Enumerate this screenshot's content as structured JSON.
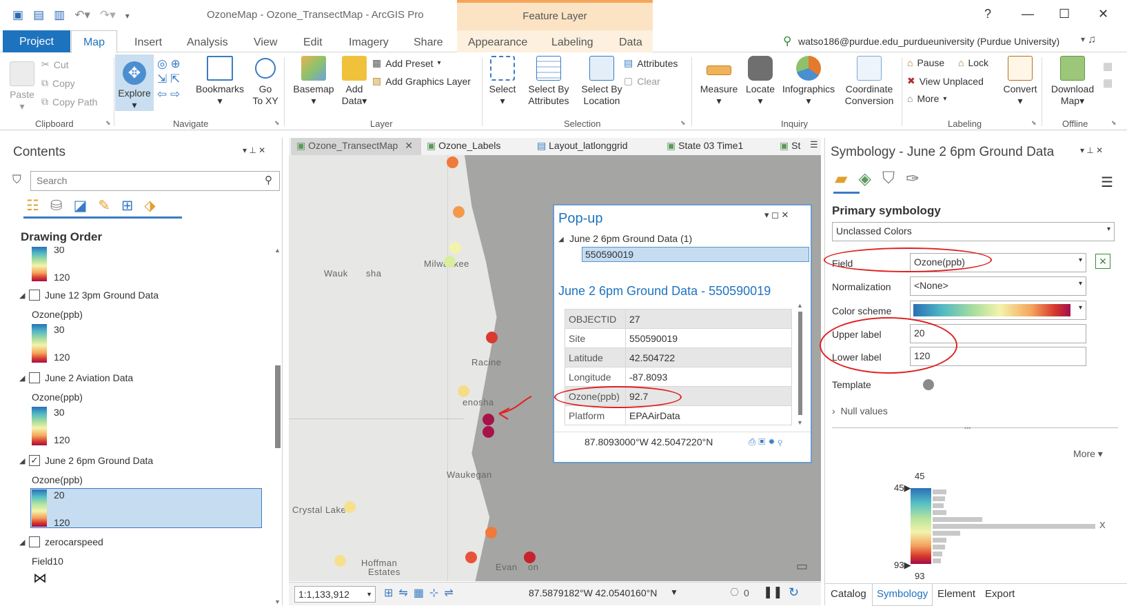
{
  "window": {
    "title": "OzoneMap - Ozone_TransectMap - ArcGIS Pro",
    "context_tab": "Feature Layer",
    "help": "?",
    "minimize": "—",
    "maximize": "☐",
    "close": "✕"
  },
  "ribbon_tabs": [
    "Project",
    "Map",
    "Insert",
    "Analysis",
    "View",
    "Edit",
    "Imagery",
    "Share",
    "Appearance",
    "Labeling",
    "Data"
  ],
  "user": "watso186@purdue.edu_purdueuniversity (Purdue University)",
  "ribbon": {
    "clipboard": {
      "paste": "Paste",
      "cut": "Cut",
      "copy": "Copy",
      "copy_path": "Copy Path",
      "label": "Clipboard"
    },
    "navigate": {
      "explore": "Explore",
      "bookmarks": "Bookmarks",
      "go_to": "Go",
      "go_to2": "To XY",
      "label": "Navigate"
    },
    "layer": {
      "basemap": "Basemap",
      "add": "Add",
      "data": "Data",
      "add_preset": "Add Preset",
      "add_graphics": "Add Graphics Layer",
      "label": "Layer"
    },
    "selection": {
      "select": "Select",
      "select_by_attr": "Select By",
      "select_by_attr2": "Attributes",
      "select_by_loc": "Select By",
      "select_by_loc2": "Location",
      "attributes": "Attributes",
      "clear": "Clear",
      "label": "Selection"
    },
    "inquiry": {
      "measure": "Measure",
      "locate": "Locate",
      "infographics": "Infographics",
      "coord": "Coordinate",
      "coord2": "Conversion",
      "label": "Inquiry"
    },
    "labeling": {
      "pause": "Pause",
      "lock": "Lock",
      "view_unplaced": "View Unplaced",
      "more": "More",
      "convert": "Convert",
      "label": "Labeling"
    },
    "offline": {
      "download": "Download",
      "download2": "Map",
      "label": "Offline"
    }
  },
  "contents": {
    "title": "Contents",
    "search_placeholder": "Search",
    "drawing_order": "Drawing Order",
    "top_partial": {
      "hi": "30",
      "lo": "120"
    },
    "layers": [
      {
        "name": "June 12 3pm Ground Data",
        "field": "Ozone(ppb)",
        "hi": "30",
        "lo": "120",
        "checked": false
      },
      {
        "name": "June 2 Aviation Data",
        "field": "Ozone(ppb)",
        "hi": "30",
        "lo": "120",
        "checked": false
      },
      {
        "name": "June 2 6pm Ground Data",
        "field": "Ozone(ppb)",
        "hi": "20",
        "lo": "120",
        "checked": true
      },
      {
        "name": "zerocarspeed",
        "field": "Field10",
        "checked": false
      }
    ]
  },
  "map_tabs": [
    "Ozone_TransectMap",
    "Ozone_Labels",
    "Layout_latlonggrid",
    "State 03 Time1",
    "St"
  ],
  "map": {
    "cities": [
      "Wauk",
      "sha",
      "Milwaukee",
      "Racine",
      "enosha",
      "Waukegan",
      "Crystal Lake",
      "Hoffman",
      "Estates",
      "Evan",
      "on"
    ],
    "scale": "1:1,133,912",
    "coords": "87.5879182°W 42.0540160°N",
    "selection_count": "0"
  },
  "popup": {
    "title": "Pop-up",
    "layer": "June 2 6pm Ground Data  (1)",
    "feature": "550590019",
    "heading": "June 2 6pm Ground Data - 550590019",
    "rows": [
      {
        "k": "OBJECTID",
        "v": "27"
      },
      {
        "k": "Site",
        "v": "550590019"
      },
      {
        "k": "Latitude",
        "v": "42.504722"
      },
      {
        "k": "Longitude",
        "v": "-87.8093"
      },
      {
        "k": "Ozone(ppb)",
        "v": "92.7"
      },
      {
        "k": "Platform",
        "v": "EPAAirData"
      }
    ],
    "coords": "87.8093000°W 42.5047220°N"
  },
  "symbology": {
    "title": "Symbology - June 2 6pm Ground Data",
    "primary": "Primary symbology",
    "method": "Unclassed Colors",
    "field_label": "Field",
    "field_value": "Ozone(ppb)",
    "norm_label": "Normalization",
    "norm_value": "<None>",
    "scheme_label": "Color scheme",
    "upper_label": "Upper label",
    "upper_value": "20",
    "lower_label": "Lower label",
    "lower_value": "120",
    "template_label": "Template",
    "null_values": "Null values",
    "more": "More",
    "hist_top": "45",
    "hist_top_marker": "45",
    "hist_bottom_marker": "93",
    "hist_bottom": "93",
    "hist_x": "X",
    "bottom_tabs": [
      "Catalog",
      "Symbology",
      "Element",
      "Export"
    ]
  },
  "colors": {
    "accent": "#1e73be",
    "annotation": "#e02020",
    "lake": "#a5a5a3",
    "land": "#e7e7e5"
  }
}
